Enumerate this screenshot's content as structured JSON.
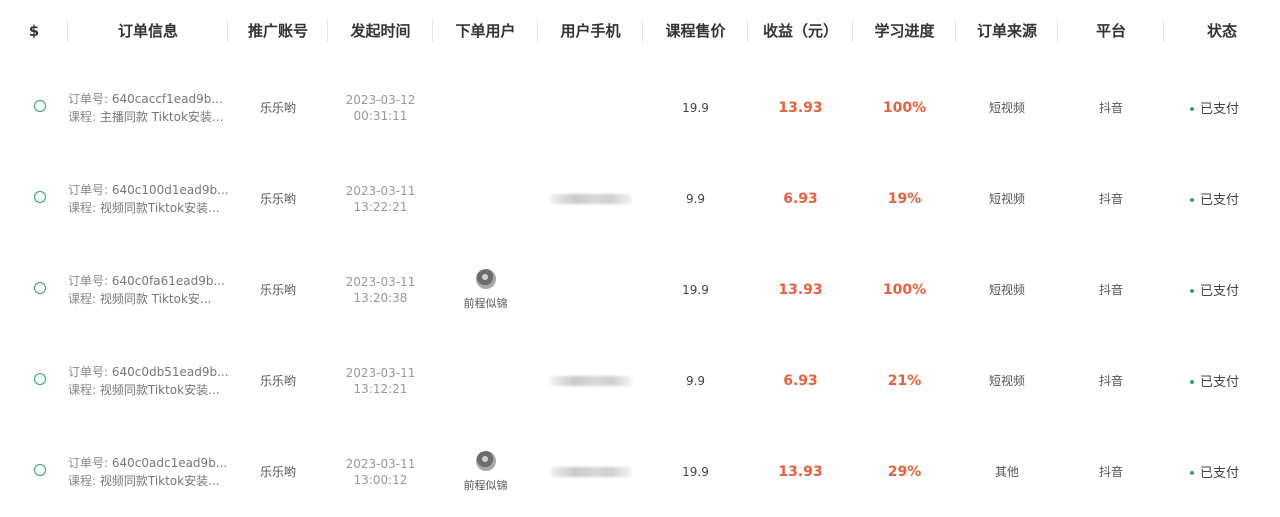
{
  "colors": {
    "accent_green": "#2aa36b",
    "profit_orange": "#e8603c",
    "status_dot": "#2aa36b"
  },
  "header": {
    "columns": [
      "$",
      "订单信息",
      "推广账号",
      "发起时间",
      "下单用户",
      "用户手机",
      "课程售价",
      "收益（元）",
      "学习进度",
      "订单来源",
      "平台",
      "状态"
    ]
  },
  "labels": {
    "order_prefix": "订单号: ",
    "course_prefix": "课程: "
  },
  "rows": [
    {
      "order_id": "640caccf1ead9b...",
      "course": "主播同款 Tiktok安装...",
      "account": "乐乐哟",
      "date": "2023-03-12",
      "time": "00:31:11",
      "user_name": "",
      "has_avatar": false,
      "phone_blurred": false,
      "price": "19.9",
      "profit": "13.93",
      "progress": "100%",
      "source": "短视频",
      "platform": "抖音",
      "status": "已支付"
    },
    {
      "order_id": "640c100d1ead9b...",
      "course": "视频同款Tiktok安装...",
      "account": "乐乐哟",
      "date": "2023-03-11",
      "time": "13:22:21",
      "user_name": "",
      "has_avatar": false,
      "phone_blurred": true,
      "price": "9.9",
      "profit": "6.93",
      "progress": "19%",
      "source": "短视频",
      "platform": "抖音",
      "status": "已支付"
    },
    {
      "order_id": "640c0fa61ead9b...",
      "course": "视频同款 Tiktok安...",
      "account": "乐乐哟",
      "date": "2023-03-11",
      "time": "13:20:38",
      "user_name": "前程似锦",
      "has_avatar": true,
      "phone_blurred": false,
      "price": "19.9",
      "profit": "13.93",
      "progress": "100%",
      "source": "短视频",
      "platform": "抖音",
      "status": "已支付"
    },
    {
      "order_id": "640c0db51ead9b...",
      "course": "视频同款Tiktok安装...",
      "account": "乐乐哟",
      "date": "2023-03-11",
      "time": "13:12:21",
      "user_name": "",
      "has_avatar": false,
      "phone_blurred": true,
      "price": "9.9",
      "profit": "6.93",
      "progress": "21%",
      "source": "短视频",
      "platform": "抖音",
      "status": "已支付"
    },
    {
      "order_id": "640c0adc1ead9b...",
      "course": "视频同款Tiktok安装...",
      "account": "乐乐哟",
      "date": "2023-03-11",
      "time": "13:00:12",
      "user_name": "前程似锦",
      "has_avatar": true,
      "phone_blurred": true,
      "price": "19.9",
      "profit": "13.93",
      "progress": "29%",
      "source": "其他",
      "platform": "抖音",
      "status": "已支付"
    }
  ]
}
